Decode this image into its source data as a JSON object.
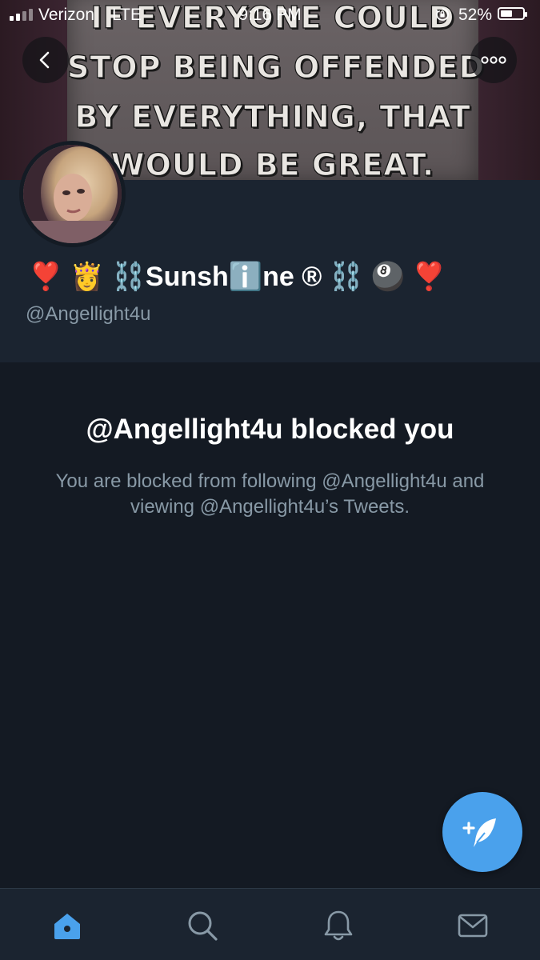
{
  "status_bar": {
    "carrier": "Verizon",
    "network": "LTE",
    "time": "9:16 PM",
    "battery_percent": "52%",
    "battery_level": 0.52,
    "signal_bars": 2
  },
  "banner": {
    "lines": [
      "IF EVERYONE COULD",
      "STOP BEING OFFENDED",
      "BY EVERYTHING, THAT",
      "WOULD BE GREAT."
    ]
  },
  "profile": {
    "display_name": "❣️ 👸 ⛓️Sunshℹ️ne ® ⛓️ 🎱 ❣️",
    "handle": "@Angellight4u"
  },
  "blocked": {
    "title": "@Angellight4u blocked you",
    "description": "You are blocked from following @Angellight4u and viewing @Angellight4u’s Tweets."
  },
  "tabs": {
    "home": "home-icon",
    "search": "search-icon",
    "notifications": "bell-icon",
    "messages": "envelope-icon",
    "active": "home"
  },
  "colors": {
    "accent": "#4aa1ec",
    "background": "#141a23",
    "header": "#1b2430",
    "secondary_text": "#8899a6"
  }
}
